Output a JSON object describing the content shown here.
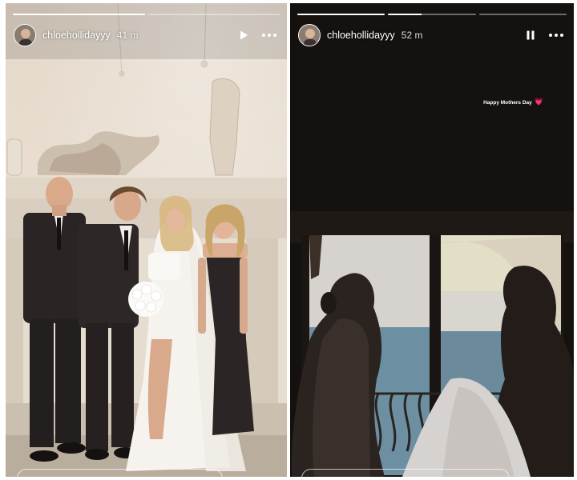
{
  "stories": [
    {
      "username": "chloehollidayyy",
      "time": "41 m",
      "control_icon": "play-icon",
      "more_icon": "more-horizontal-icon",
      "progress": [
        1.0,
        0.0
      ]
    },
    {
      "username": "chloehollidayyy",
      "time": "52 m",
      "control_icon": "pause-icon",
      "more_icon": "more-horizontal-icon",
      "progress": [
        1.0,
        0.38,
        0.0
      ],
      "caption": "Happy Mothers Day",
      "caption_emoji": "💗"
    }
  ],
  "colors": {
    "wall": "#e9e0d4",
    "dark_room": "#14110f",
    "sea": "#6d8fa2",
    "sky": "#d7d3cf"
  }
}
